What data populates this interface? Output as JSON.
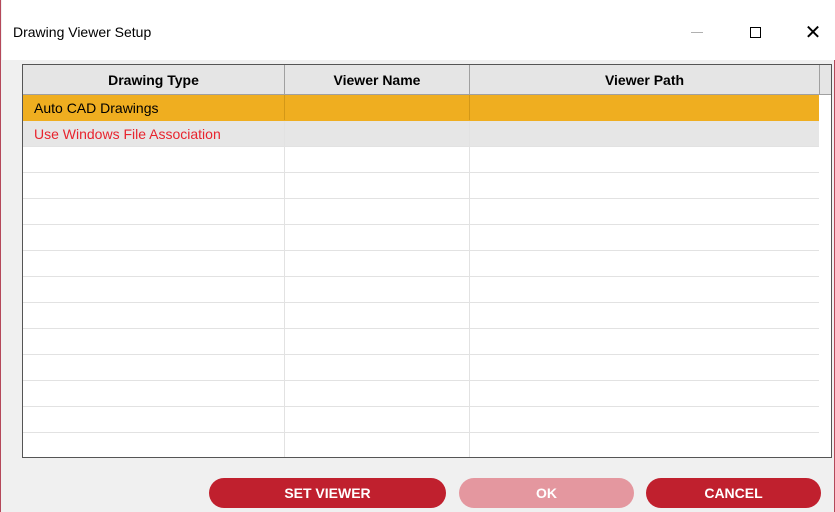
{
  "window": {
    "title": "Drawing Viewer Setup",
    "controls": {
      "minimize_icon": "minimize-icon",
      "maximize_icon": "maximize-icon",
      "close_icon": "close-icon",
      "close_glyph": "✕"
    }
  },
  "grid": {
    "columns": [
      "Drawing Type",
      "Viewer Name",
      "Viewer Path"
    ],
    "rows": [
      {
        "type": "Auto CAD Drawings",
        "name": "",
        "path": "",
        "state": "selected"
      },
      {
        "type": "Use Windows File Association",
        "name": "",
        "path": "",
        "state": "highlighted-red"
      }
    ],
    "empty_row_count": 12
  },
  "buttons": {
    "set_viewer": "SET VIEWER",
    "ok": "OK",
    "cancel": "CANCEL"
  },
  "colors": {
    "selection": "#efae20",
    "button_primary": "#c0202e",
    "button_disabled": "#e4979f",
    "row_text_red": "#e8242e"
  }
}
